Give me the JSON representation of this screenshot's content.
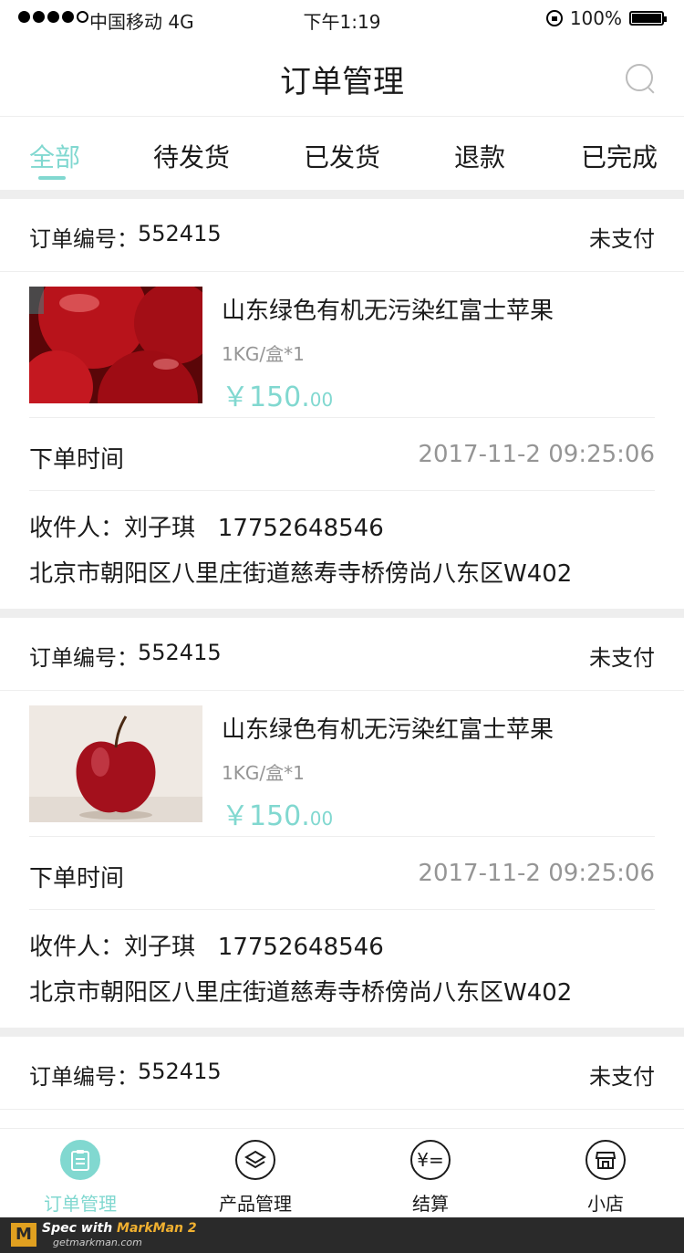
{
  "status_bar": {
    "carrier": "中国移动 4G",
    "time": "下午1:19",
    "battery": "100%"
  },
  "nav": {
    "title": "订单管理"
  },
  "tabs": [
    {
      "label": "全部",
      "active": true
    },
    {
      "label": "待发货",
      "active": false
    },
    {
      "label": "已发货",
      "active": false
    },
    {
      "label": "退款",
      "active": false
    },
    {
      "label": "已完成",
      "active": false
    }
  ],
  "orders": [
    {
      "no_label": "订单编号：",
      "no_value": "552415",
      "status": "未支付",
      "product_name": "山东绿色有机无污染红富士苹果",
      "spec": "1KG/盒*1",
      "price_main": "￥150.",
      "price_cents": "00",
      "time_label": "下单时间",
      "time_value": "2017-11-2 09:25:06",
      "recipient": "收件人：刘子琪   17752648546",
      "address": "北京市朝阳区八里庄街道慈寿寺桥傍尚八东区W402"
    },
    {
      "no_label": "订单编号：",
      "no_value": "552415",
      "status": "未支付",
      "product_name": "山东绿色有机无污染红富士苹果",
      "spec": "1KG/盒*1",
      "price_main": "￥150.",
      "price_cents": "00",
      "time_label": "下单时间",
      "time_value": "2017-11-2 09:25:06",
      "recipient": "收件人：刘子琪   17752648546",
      "address": "北京市朝阳区八里庄街道慈寿寺桥傍尚八东区W402"
    },
    {
      "no_label": "订单编号：",
      "no_value": "552415",
      "status": "未支付"
    }
  ],
  "tabbar": [
    {
      "label": "订单管理",
      "icon": "clipboard-icon",
      "active": true
    },
    {
      "label": "产品管理",
      "icon": "layers-icon",
      "active": false
    },
    {
      "label": "结算",
      "icon": "yuan-icon",
      "active": false
    },
    {
      "label": "小店",
      "icon": "shop-icon",
      "active": false
    }
  ],
  "banner": {
    "brand_prefix": "Spec with ",
    "brand": "MarkMan 2",
    "url": "getmarkman.com"
  },
  "colors": {
    "accent": "#81d8d0",
    "text": "#1b1b1b",
    "muted": "#959595",
    "divider": "#eeeeee"
  }
}
